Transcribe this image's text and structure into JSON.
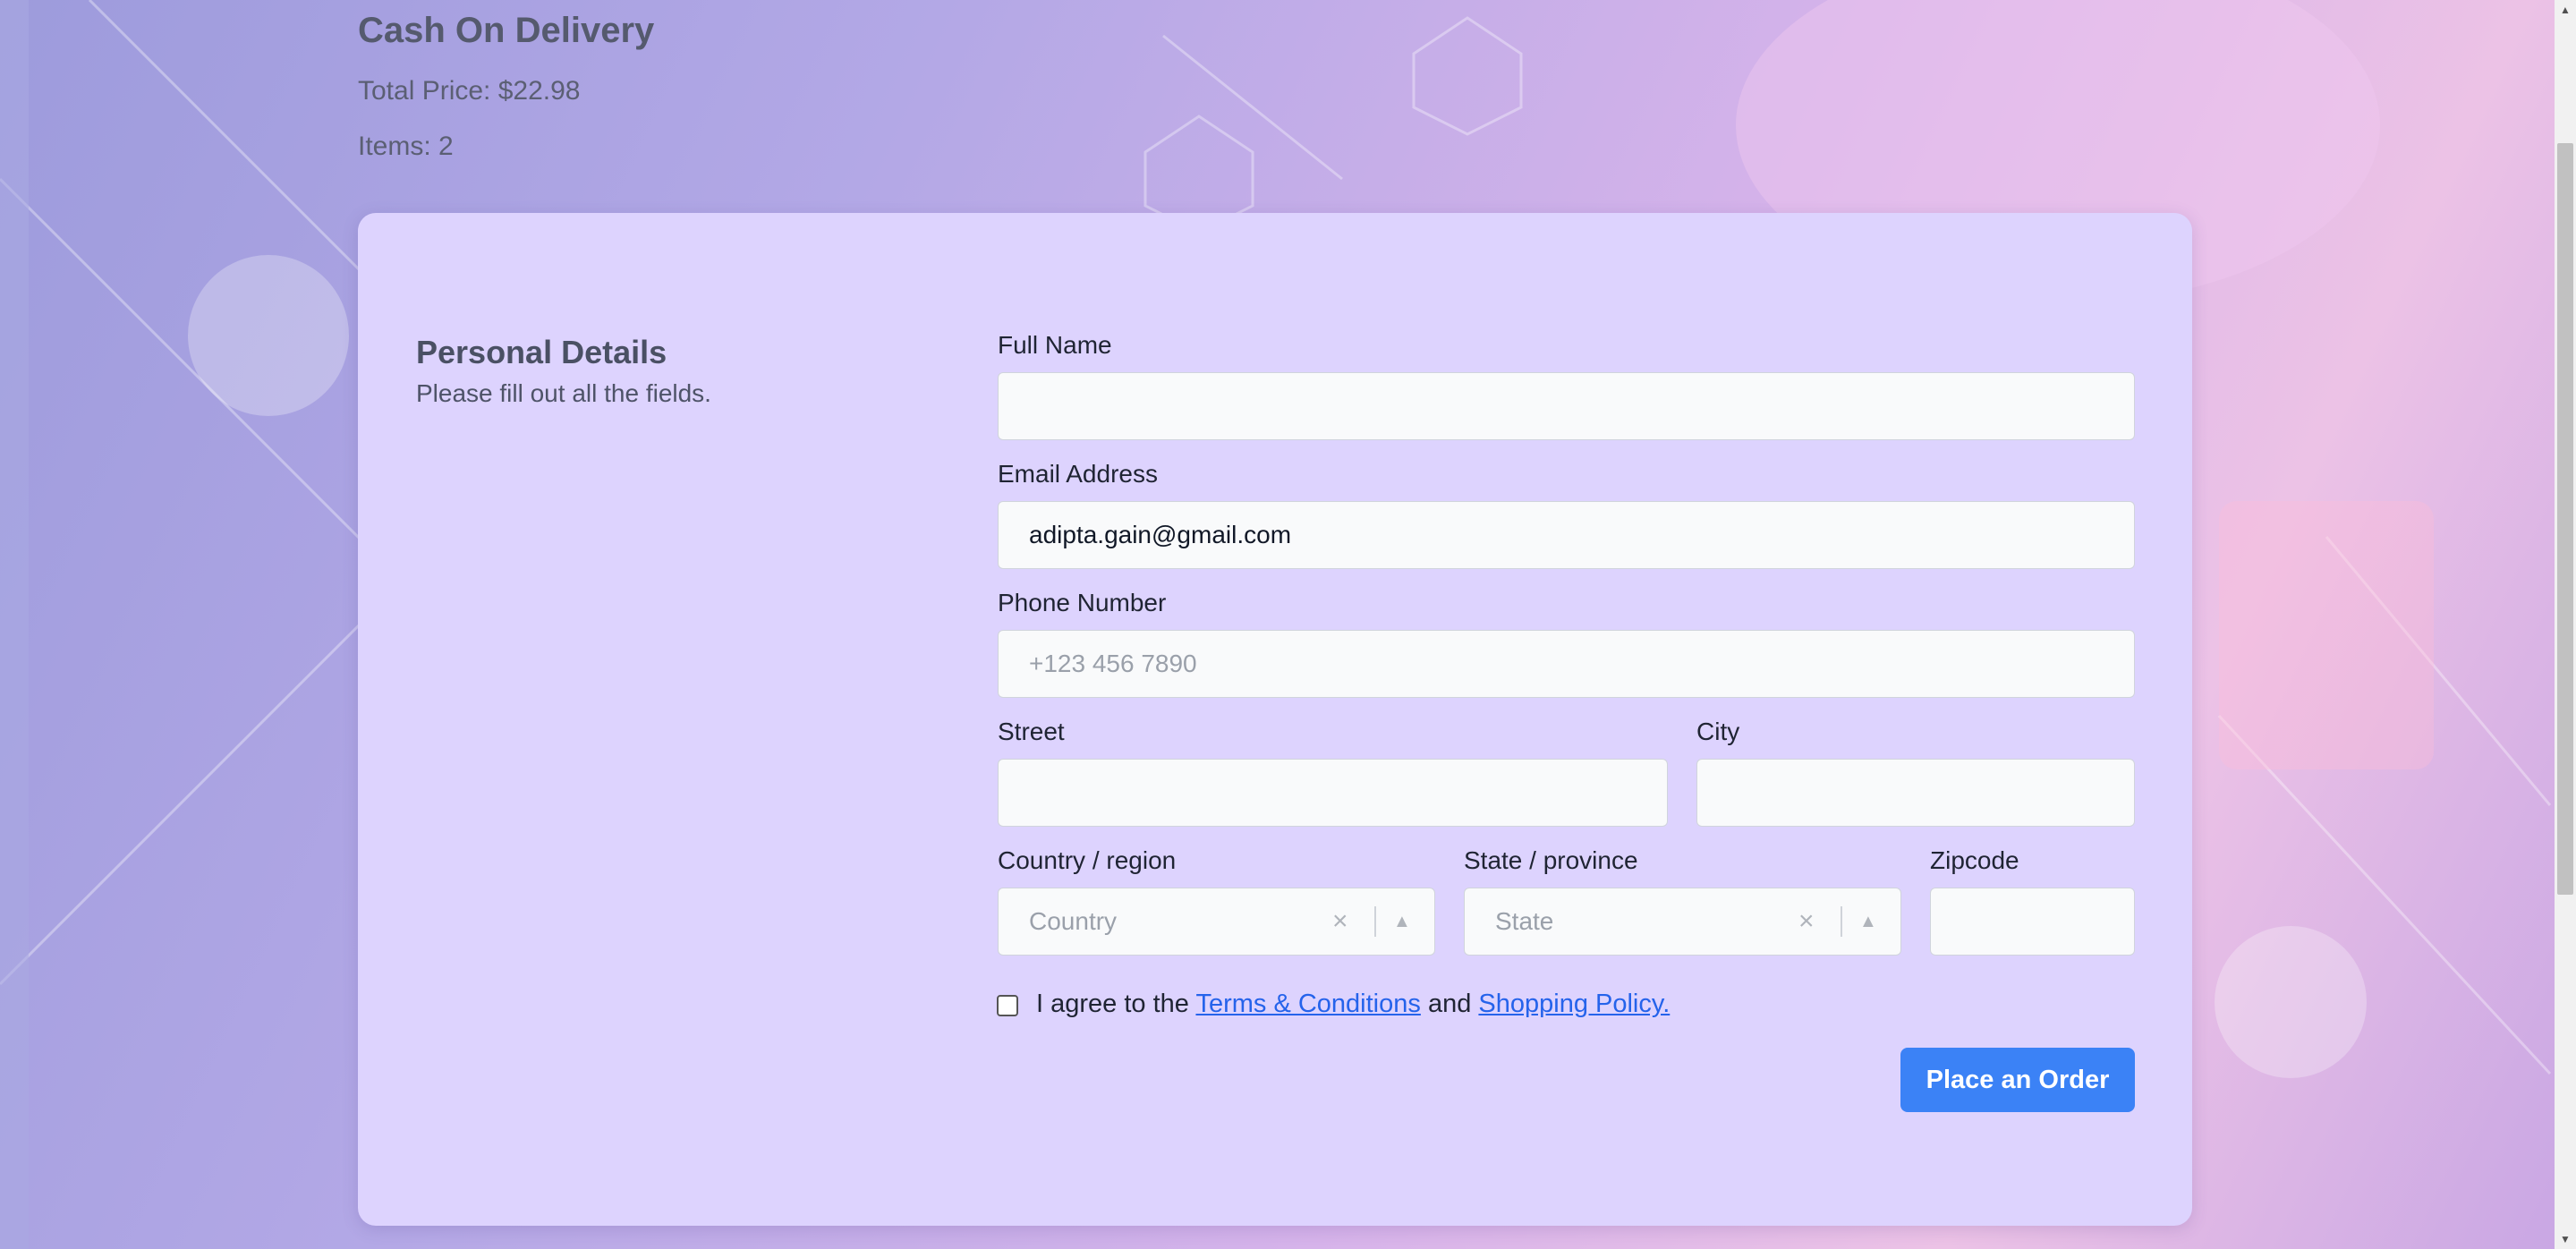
{
  "summary": {
    "title": "Cash On Delivery",
    "total_price": "Total Price: $22.98",
    "items": "Items: 2"
  },
  "personal": {
    "title": "Personal Details",
    "subtitle": "Please fill out all the fields."
  },
  "fields": {
    "full_name": {
      "label": "Full Name",
      "value": "",
      "placeholder": ""
    },
    "email": {
      "label": "Email Address",
      "value": "adipta.gain@gmail.com"
    },
    "phone": {
      "label": "Phone Number",
      "placeholder": "+123 456 7890"
    },
    "street": {
      "label": "Street",
      "value": ""
    },
    "city": {
      "label": "City",
      "value": ""
    },
    "country": {
      "label": "Country / region",
      "placeholder": "Country"
    },
    "state": {
      "label": "State / province",
      "placeholder": "State"
    },
    "zipcode": {
      "label": "Zipcode",
      "value": ""
    }
  },
  "agreement": {
    "prefix": "I agree to the",
    "terms_link": "Terms & Conditions",
    "middle": "and",
    "policy_link": "Shopping Policy.",
    "checked": false
  },
  "submit_label": "Place an Order",
  "colors": {
    "card": "#ddd3fe",
    "primary": "#3b82f6",
    "link": "#2563eb"
  },
  "icons": [
    "clear-icon",
    "chevron-up-icon",
    "scroll-up-arrow-icon",
    "scroll-down-arrow-icon"
  ]
}
